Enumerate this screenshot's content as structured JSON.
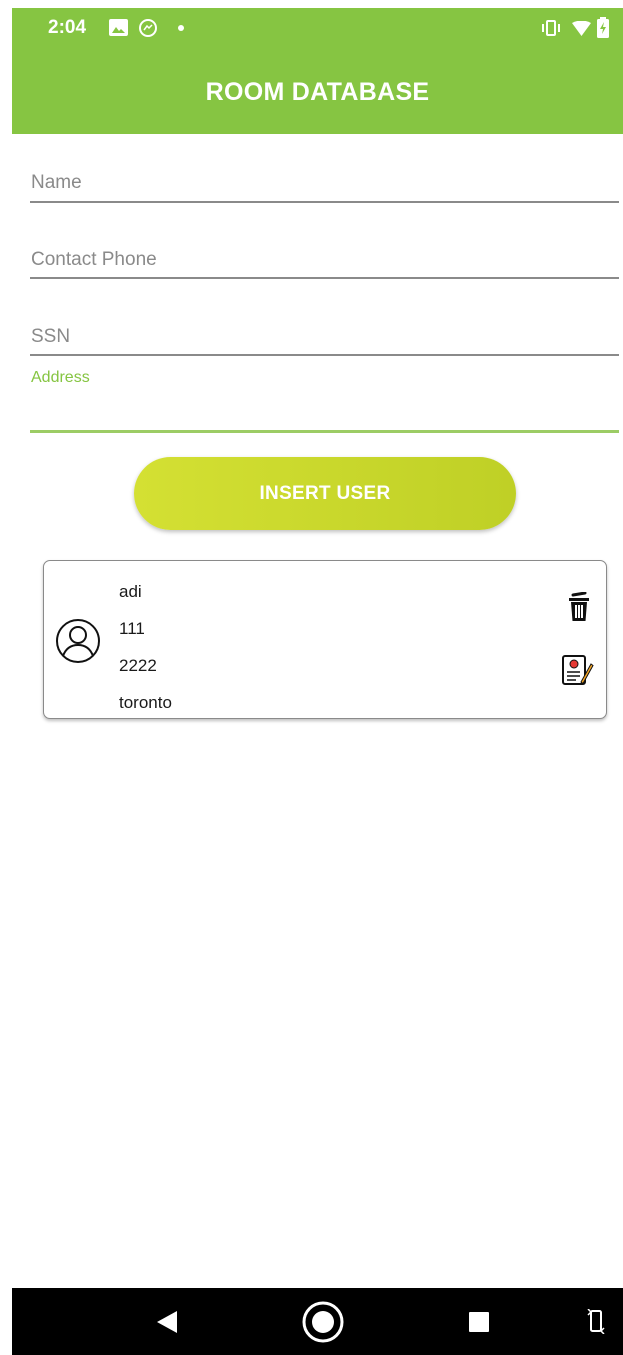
{
  "status_bar": {
    "time": "2:04",
    "left_icons": [
      "image-icon",
      "messenger-icon",
      "dot-icon"
    ],
    "right_icons": [
      "vibrate-icon",
      "wifi-icon",
      "battery-icon"
    ]
  },
  "app_bar": {
    "title": "ROOM DATABASE",
    "color": "#86c542"
  },
  "form": {
    "name": {
      "placeholder": "Name",
      "value": ""
    },
    "phone": {
      "placeholder": "Contact Phone",
      "value": ""
    },
    "ssn": {
      "placeholder": "SSN",
      "value": ""
    },
    "address": {
      "label": "Address",
      "value": "",
      "focused": true
    }
  },
  "insert_button": {
    "label": "INSERT USER"
  },
  "users": [
    {
      "name": "adi",
      "phone": "111",
      "ssn": "2222",
      "address": "toronto"
    }
  ],
  "nav_bar": {
    "buttons": [
      "back-icon",
      "home-icon",
      "recents-icon",
      "rotate-icon"
    ]
  }
}
